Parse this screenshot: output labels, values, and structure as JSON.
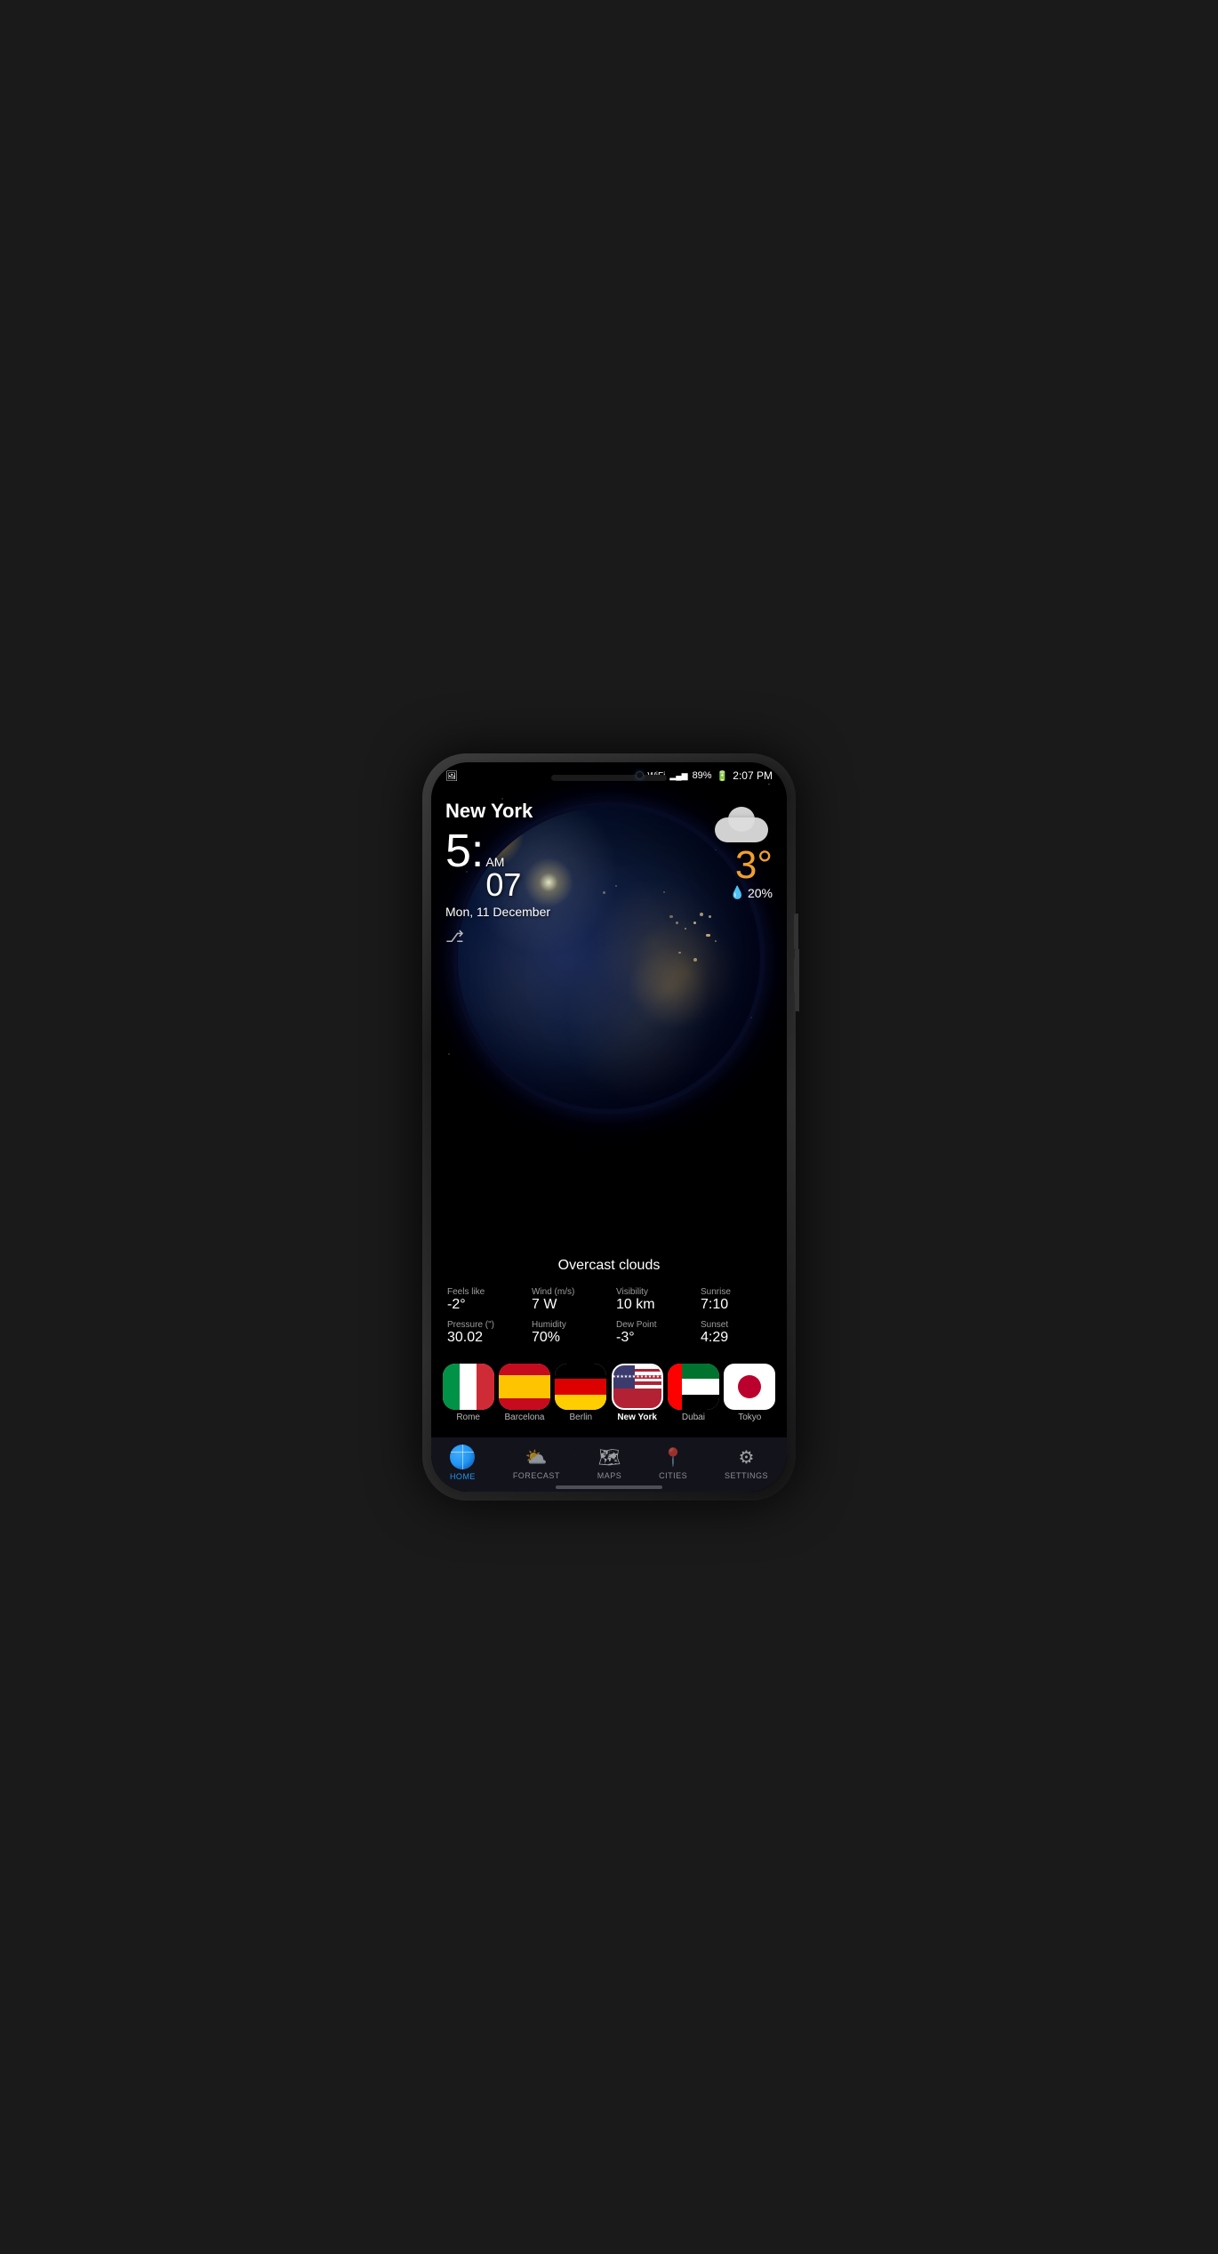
{
  "phone": {
    "status_bar": {
      "time": "2:07 PM",
      "battery": "89%",
      "signal_bars": "▂▄▆",
      "wifi": "wifi",
      "location": "⊙"
    },
    "weather": {
      "city": "New York",
      "time_hour": "5",
      "time_colon": ":",
      "time_minutes": "07",
      "time_ampm": "AM",
      "date": "Mon, 11 December",
      "temperature": "3°",
      "precipitation": "20%",
      "description": "Overcast clouds",
      "feels_like_label": "Feels like",
      "feels_like_value": "-2°",
      "wind_label": "Wind (m/s)",
      "wind_value": "7 W",
      "visibility_label": "Visibility",
      "visibility_value": "10 km",
      "sunrise_label": "Sunrise",
      "sunrise_value": "7:10",
      "pressure_label": "Pressure (\")",
      "pressure_value": "30.02",
      "humidity_label": "Humidity",
      "humidity_value": "70%",
      "dew_point_label": "Dew Point",
      "dew_point_value": "-3°",
      "sunset_label": "Sunset",
      "sunset_value": "4:29"
    },
    "cities": [
      {
        "name": "Rome",
        "flag": "italy",
        "active": false
      },
      {
        "name": "Barcelona",
        "flag": "spain",
        "active": false
      },
      {
        "name": "Berlin",
        "flag": "germany",
        "active": false
      },
      {
        "name": "New York",
        "flag": "usa",
        "active": true
      },
      {
        "name": "Dubai",
        "flag": "uae",
        "active": false
      },
      {
        "name": "Tokyo",
        "flag": "japan",
        "active": false
      }
    ],
    "nav": {
      "items": [
        {
          "id": "home",
          "label": "HOME",
          "active": true
        },
        {
          "id": "forecast",
          "label": "FORECAST",
          "active": false
        },
        {
          "id": "maps",
          "label": "MAPS",
          "active": false
        },
        {
          "id": "cities",
          "label": "CITIES",
          "active": false
        },
        {
          "id": "settings",
          "label": "SETTINGS",
          "active": false
        }
      ]
    }
  }
}
